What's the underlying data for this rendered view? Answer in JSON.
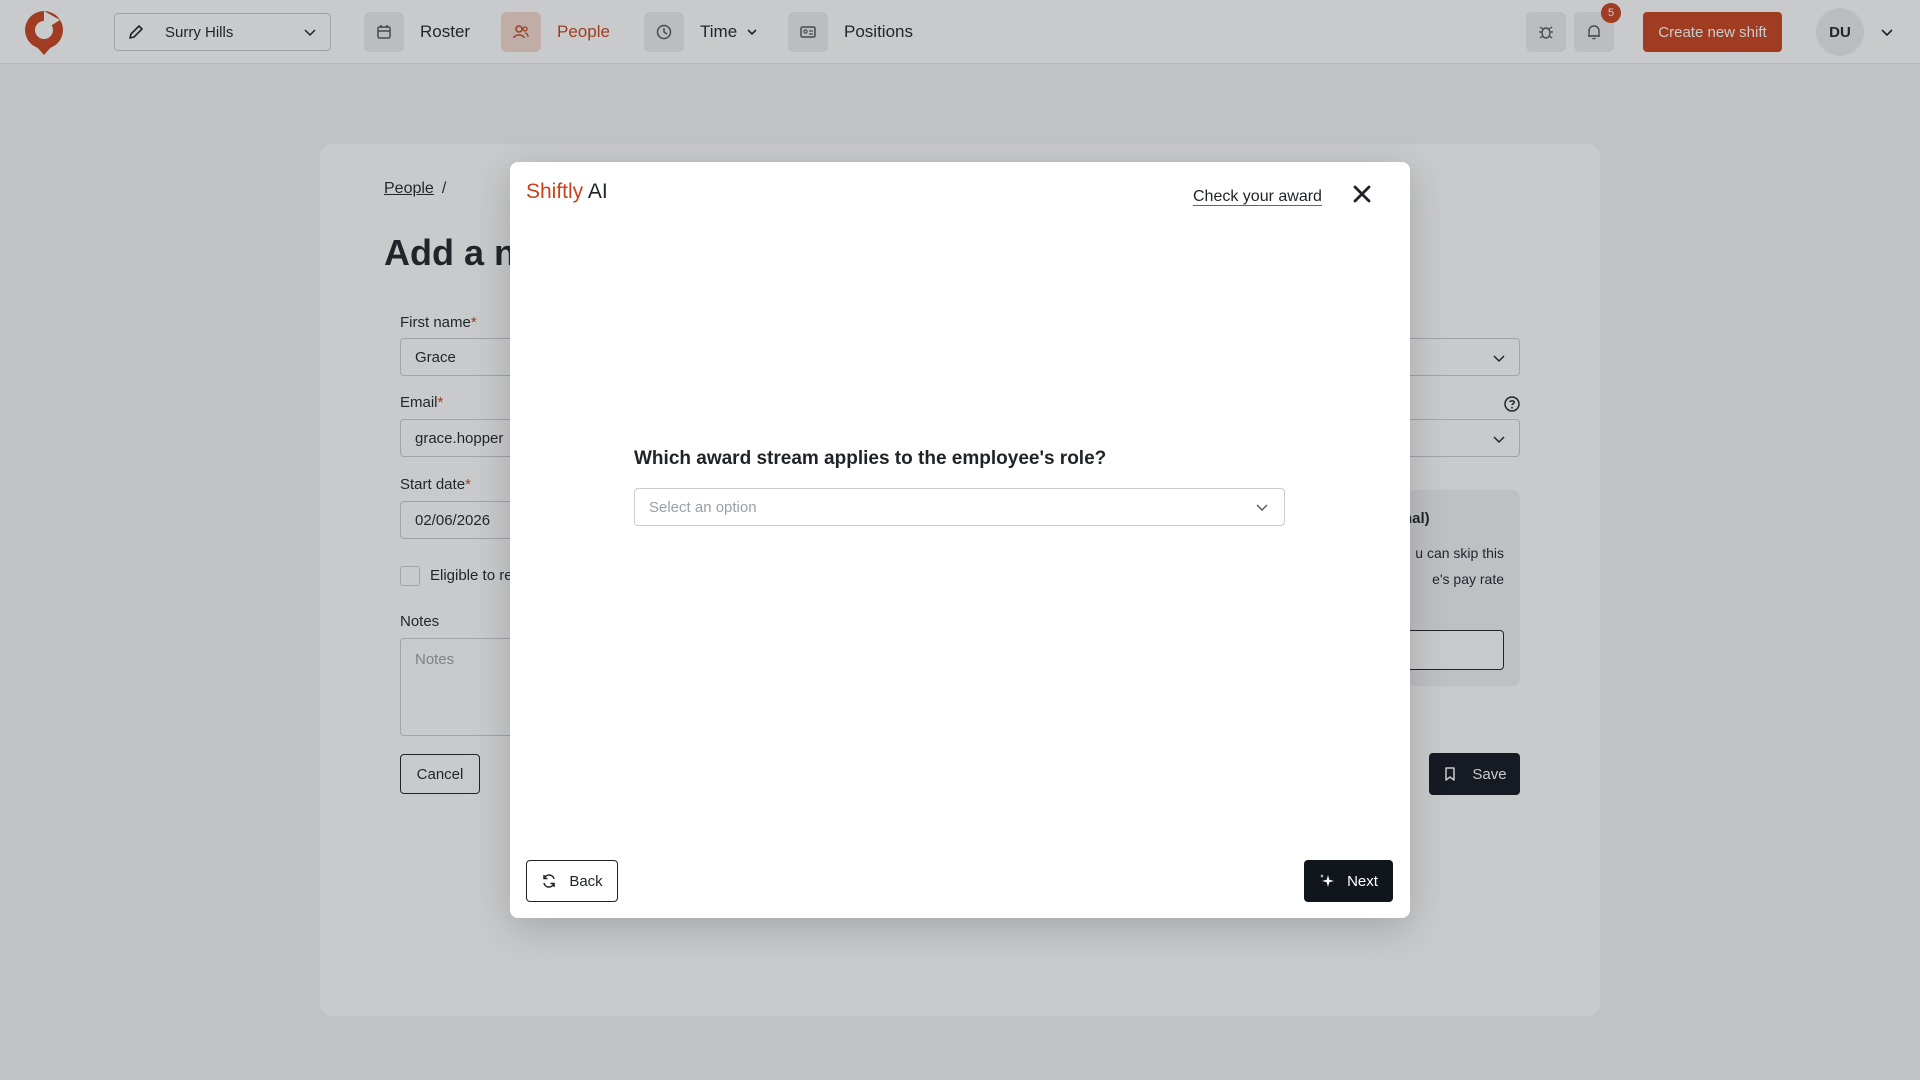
{
  "topbar": {
    "location": "Surry Hills",
    "nav": [
      {
        "label": "Roster"
      },
      {
        "label": "People"
      },
      {
        "label": "Time"
      },
      {
        "label": "Positions"
      }
    ],
    "notification_count": "5",
    "create_label": "Create new shift",
    "avatar_initials": "DU",
    "accent_color": "#c8421c"
  },
  "form": {
    "breadcrumb": "People",
    "breadcrumb_sep": "/",
    "title": "Add a ne",
    "first_name_label": "First name",
    "first_name_value": "Grace",
    "email_label": "Email",
    "email_value": "grace.hopper",
    "start_date_label": "Start date",
    "start_date_value": "02/06/2026",
    "required_mark": "*",
    "eligible_label": "Eligible to re",
    "notes_label": "Notes",
    "notes_placeholder": "Notes",
    "cancel_label": "Cancel",
    "side_panel_title": "nal)",
    "side_panel_line1": "u can skip this",
    "side_panel_line2": "e's pay rate",
    "save_label": "Save"
  },
  "modal": {
    "brand_part1": "Shiftly",
    "brand_part2": " AI",
    "check_award_label": "Check your award",
    "question": "Which award stream applies to the employee's role?",
    "select_placeholder": "Select an option",
    "back_label": "Back",
    "next_label": "Next"
  }
}
